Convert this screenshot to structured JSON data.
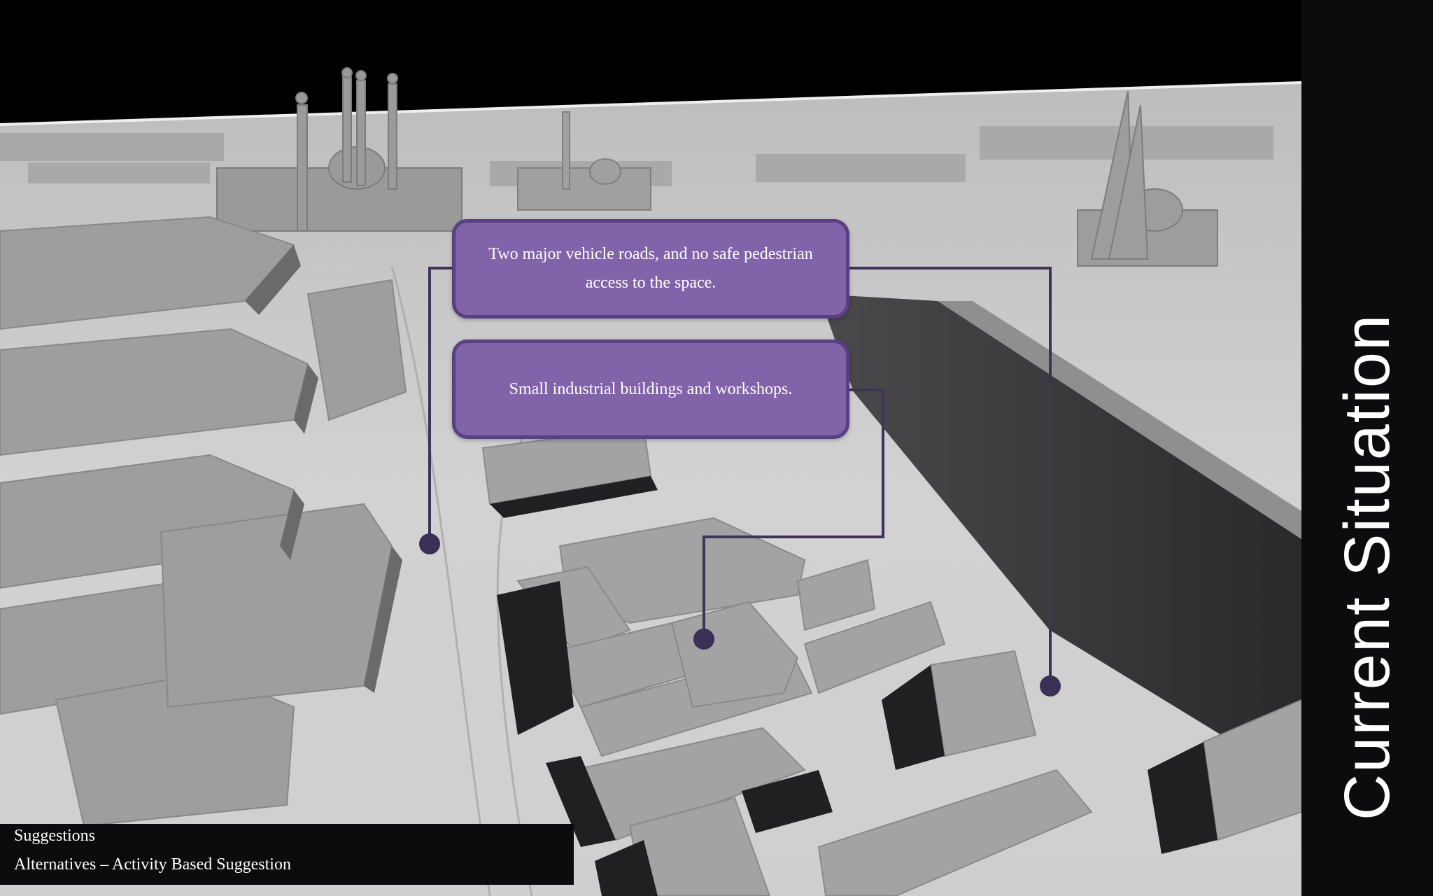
{
  "side_title": "Current Situation",
  "callouts": [
    {
      "text": "Two major vehicle roads, and no safe pedestrian access to the space."
    },
    {
      "text": "Small industrial  buildings and workshops."
    }
  ],
  "footer": {
    "line1": "Suggestions",
    "line2": "Alternatives – Activity Based Suggestion"
  },
  "colors": {
    "callout_fill": "#8063a8",
    "callout_border": "#5a3f82",
    "leader_line": "#3f3358",
    "panel": "#0c0b0d"
  }
}
